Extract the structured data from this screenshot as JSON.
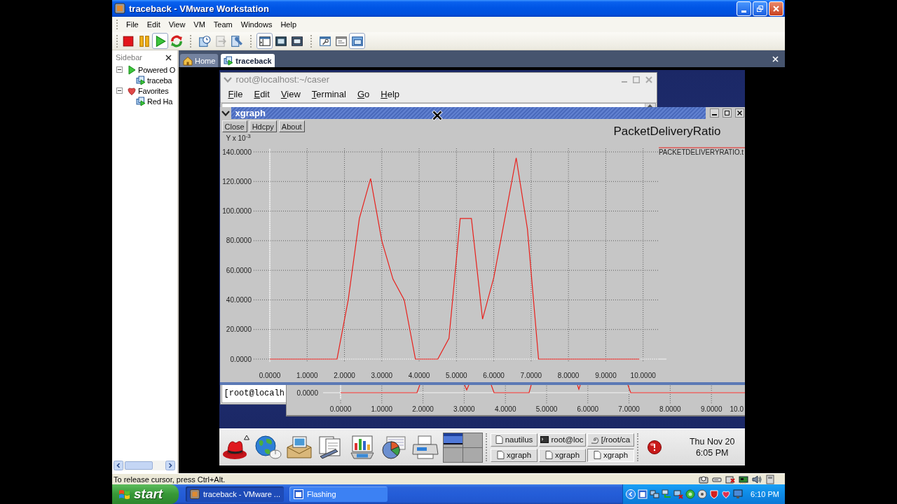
{
  "window": {
    "title": "traceback - VMware Workstation"
  },
  "menu": [
    "File",
    "Edit",
    "View",
    "VM",
    "Team",
    "Windows",
    "Help"
  ],
  "toolbar": {
    "groups": [
      {
        "buttons": [
          {
            "kind": "stop",
            "pressed": false,
            "disabled": false
          },
          {
            "kind": "pause",
            "pressed": false,
            "disabled": false
          },
          {
            "kind": "play",
            "pressed": true,
            "disabled": false
          },
          {
            "kind": "reset",
            "pressed": false,
            "disabled": false
          }
        ]
      },
      {
        "buttons": [
          {
            "kind": "snapshot",
            "pressed": false,
            "disabled": false
          },
          {
            "kind": "revert",
            "pressed": false,
            "disabled": true
          },
          {
            "kind": "manager",
            "pressed": false,
            "disabled": false
          }
        ]
      },
      {
        "buttons": [
          {
            "kind": "sidebar-view",
            "pressed": true,
            "disabled": false
          },
          {
            "kind": "full-screen",
            "pressed": false,
            "disabled": false
          },
          {
            "kind": "quick-switch",
            "pressed": false,
            "disabled": false
          }
        ]
      },
      {
        "buttons": [
          {
            "kind": "summary",
            "pressed": false,
            "disabled": false
          },
          {
            "kind": "appliance",
            "pressed": false,
            "disabled": false
          },
          {
            "kind": "console",
            "pressed": true,
            "disabled": false
          }
        ]
      }
    ]
  },
  "sidebar": {
    "title": "Sidebar",
    "items": [
      {
        "label": "Powered O",
        "kind": "running",
        "expanded": true,
        "children": [
          {
            "label": "traceba",
            "kind": "vm"
          }
        ]
      },
      {
        "label": "Favorites",
        "kind": "favorites",
        "expanded": true,
        "children": [
          {
            "label": "Red Ha",
            "kind": "vm"
          }
        ]
      }
    ]
  },
  "tabs": [
    {
      "label": "Home",
      "kind": "home",
      "selected": false
    },
    {
      "label": "traceback",
      "kind": "vm",
      "selected": true
    }
  ],
  "guest": {
    "terminal": {
      "title": "root@localhost:~/caser",
      "menu": [
        "File",
        "Edit",
        "View",
        "Terminal",
        "Go",
        "Help"
      ],
      "prompt": "[root@localh"
    },
    "xgraph": {
      "title": "xgraph",
      "buttons": [
        "Close",
        "Hdcpy",
        "About"
      ],
      "chart_data": {
        "type": "line",
        "title": "PacketDeliveryRatio",
        "ylabel": "Y x 10$^{-3}$",
        "grid": true,
        "x": [
          0,
          1.8,
          2.1,
          2.4,
          2.7,
          3.0,
          3.3,
          3.6,
          3.9,
          4.5,
          4.8,
          5.1,
          5.4,
          5.7,
          6.0,
          6.6,
          6.9,
          7.2,
          9.9
        ],
        "series": [
          {
            "name": "PACKETDELIVERYRATIO.t",
            "color": "#e8201c",
            "values": [
              0,
              0,
              40,
              95,
              122,
              80,
              54,
              40,
              0,
              0,
              14,
              95,
              95,
              27,
              55,
              136,
              88,
              0,
              0
            ]
          }
        ],
        "xlim": [
          0,
          10.4
        ],
        "ylim": [
          0,
          140
        ],
        "xticks": [
          {
            "value": 0,
            "label": "0.0000"
          },
          {
            "value": 1,
            "label": "1.0000"
          },
          {
            "value": 2,
            "label": "2.0000"
          },
          {
            "value": 3,
            "label": "3.0000"
          },
          {
            "value": 4,
            "label": "4.0000"
          },
          {
            "value": 5,
            "label": "5.0000"
          },
          {
            "value": 6,
            "label": "6.0000"
          },
          {
            "value": 7,
            "label": "7.0000"
          },
          {
            "value": 8,
            "label": "8.0000"
          },
          {
            "value": 9,
            "label": "9.0000"
          },
          {
            "value": 10,
            "label": "10.0000"
          }
        ],
        "yticks": [
          {
            "value": 0,
            "label": "0.0000"
          },
          {
            "value": 20,
            "label": "20.0000"
          },
          {
            "value": 40,
            "label": "40.0000"
          },
          {
            "value": 60,
            "label": "60.0000"
          },
          {
            "value": 80,
            "label": "80.0000"
          },
          {
            "value": 100,
            "label": "100.0000"
          },
          {
            "value": 120,
            "label": "120.0000"
          },
          {
            "value": 140,
            "label": "140.0000"
          }
        ]
      }
    },
    "xgraph_behind": {
      "y_tick": "0.0000",
      "x_ticks": [
        "0.0000",
        "1.0000",
        "2.0000",
        "3.0000",
        "4.0000",
        "5.0000",
        "6.0000",
        "7.0000",
        "8.0000",
        "9.0000",
        "10.0"
      ]
    },
    "panel": {
      "workspaces": [
        {
          "selected": true
        },
        {
          "selected": false
        },
        {
          "selected": false
        },
        {
          "selected": false
        }
      ],
      "tasks": [
        {
          "label": "nautilus",
          "kind": "page",
          "selected": false
        },
        {
          "label": "root@loc",
          "kind": "terminal",
          "selected": false
        },
        {
          "label": "[/root/ca",
          "kind": "shell",
          "selected": false
        },
        {
          "label": "xgraph",
          "kind": "page",
          "selected": false
        },
        {
          "label": "xgraph",
          "kind": "page",
          "selected": false
        },
        {
          "label": "xgraph",
          "kind": "page",
          "selected": true
        }
      ],
      "clock": {
        "date": "Thu Nov 20",
        "time": "6:05 PM"
      }
    }
  },
  "status_bar": {
    "text": "To release cursor, press Ctrl+Alt."
  },
  "taskbar": {
    "start": "start",
    "tasks": [
      {
        "label": "traceback - VMware ...",
        "kind": "vmware",
        "selected": true
      },
      {
        "label": "Flashing",
        "kind": "window",
        "selected": false
      }
    ],
    "clock": "6:10 PM"
  }
}
